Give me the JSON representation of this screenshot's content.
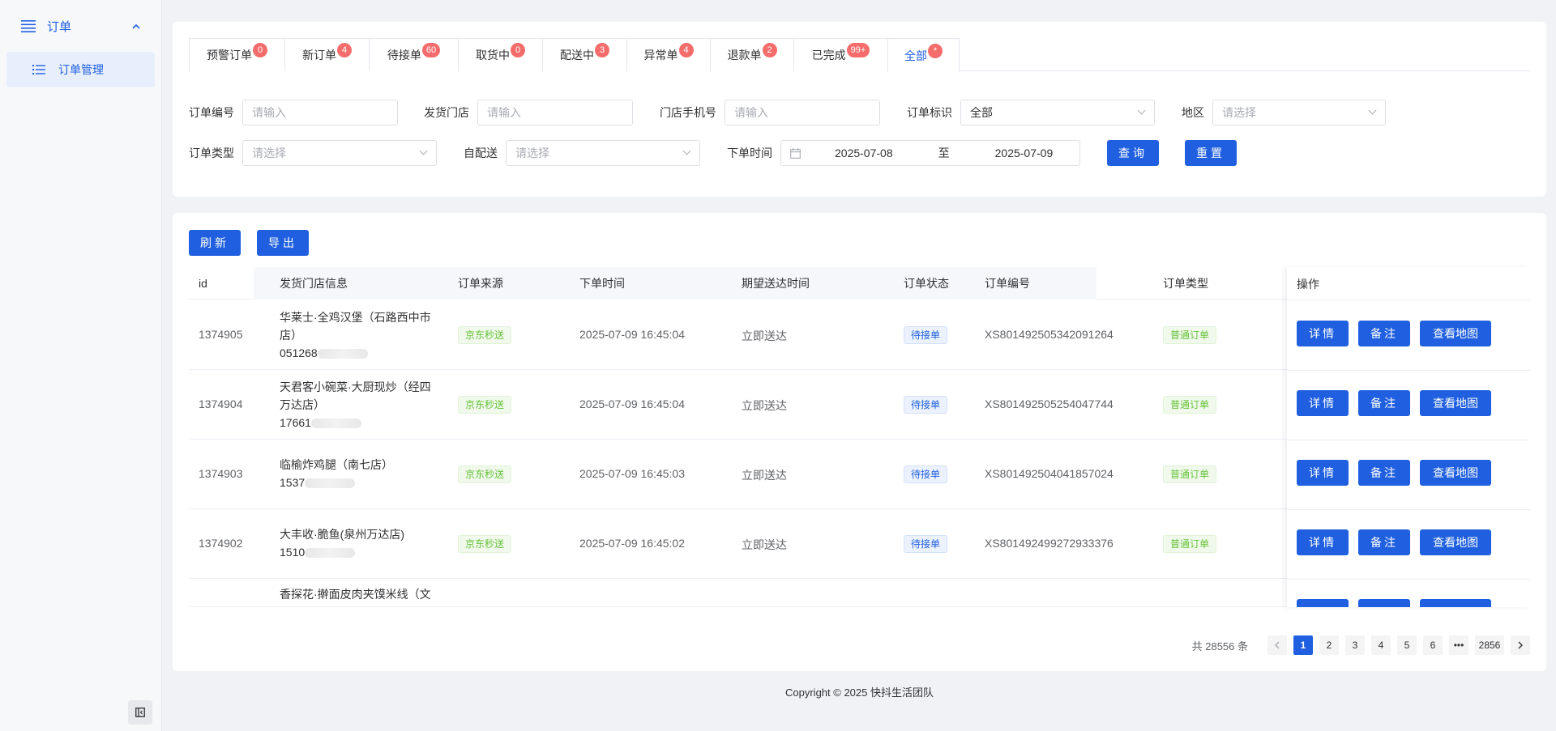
{
  "sidebar": {
    "group_label": "订单",
    "item_label": "订单管理"
  },
  "tabs": [
    {
      "label": "预警订单",
      "badge": "0"
    },
    {
      "label": "新订单",
      "badge": "4"
    },
    {
      "label": "待接单",
      "badge": "60"
    },
    {
      "label": "取货中",
      "badge": "0"
    },
    {
      "label": "配送中",
      "badge": "3"
    },
    {
      "label": "异常单",
      "badge": "4"
    },
    {
      "label": "退款单",
      "badge": "2"
    },
    {
      "label": "已完成",
      "badge": "99+"
    },
    {
      "label": "全部",
      "badge": "*"
    }
  ],
  "filters": {
    "order_no": {
      "label": "订单编号",
      "placeholder": "请输入"
    },
    "store": {
      "label": "发货门店",
      "placeholder": "请输入"
    },
    "phone": {
      "label": "门店手机号",
      "placeholder": "请输入"
    },
    "flag": {
      "label": "订单标识",
      "value": "全部"
    },
    "region": {
      "label": "地区",
      "placeholder": "请选择"
    },
    "type": {
      "label": "订单类型",
      "placeholder": "请选择"
    },
    "self_delivery": {
      "label": "自配送",
      "placeholder": "请选择"
    },
    "time": {
      "label": "下单时间",
      "start": "2025-07-08",
      "sep": "至",
      "end": "2025-07-09"
    },
    "query_label": "查询",
    "reset_label": "重置"
  },
  "toolbar": {
    "refresh_label": "刷新",
    "export_label": "导出"
  },
  "table": {
    "columns": [
      "id",
      "发货门店信息",
      "订单来源",
      "下单时间",
      "期望送达时间",
      "订单状态",
      "订单编号",
      "订单类型",
      "操作"
    ],
    "rows": [
      {
        "id": "1374905",
        "store_line1": "华莱士·全鸡汉堡（石路西中市",
        "store_line2": "店）",
        "phone": "051268",
        "source": "京东秒送",
        "time": "2025-07-09 16:45:04",
        "eta": "立即送达",
        "status": "待接单",
        "order_no": "XS801492505342091264",
        "type": "普通订单"
      },
      {
        "id": "1374904",
        "store_line1": "天君客小碗菜·大厨现炒（经四",
        "store_line2": "万达店）",
        "phone": "17661",
        "source": "京东秒送",
        "time": "2025-07-09 16:45:04",
        "eta": "立即送达",
        "status": "待接单",
        "order_no": "XS801492505254047744",
        "type": "普通订单"
      },
      {
        "id": "1374903",
        "store_line1": "临榆炸鸡腿（南七店）",
        "store_line2": "",
        "phone": "1537",
        "source": "京东秒送",
        "time": "2025-07-09 16:45:03",
        "eta": "立即送达",
        "status": "待接单",
        "order_no": "XS801492504041857024",
        "type": "普通订单"
      },
      {
        "id": "1374902",
        "store_line1": "大丰收·脆鱼(泉州万达店)",
        "store_line2": "",
        "phone": "1510",
        "source": "京东秒送",
        "time": "2025-07-09 16:45:02",
        "eta": "立即送达",
        "status": "待接单",
        "order_no": "XS801492499272933376",
        "type": "普通订单"
      },
      {
        "id": "",
        "store_line1": "香探花·擀面皮肉夹馍米线（文",
        "store_line2": "",
        "phone": "",
        "source": "",
        "time": "",
        "eta": "",
        "status": "",
        "order_no": "",
        "type": ""
      }
    ],
    "actions": {
      "detail": "详情",
      "remark": "备注",
      "map": "查看地图"
    }
  },
  "pagination": {
    "total": "共 28556 条",
    "pages": [
      "1",
      "2",
      "3",
      "4",
      "5",
      "6",
      "•••",
      "2856"
    ]
  },
  "footer": "Copyright © 2025 快抖生活团队",
  "colors": {
    "primary": "#1f5fe0",
    "badge": "#f56c6c",
    "tag_green": "#67c23a"
  }
}
